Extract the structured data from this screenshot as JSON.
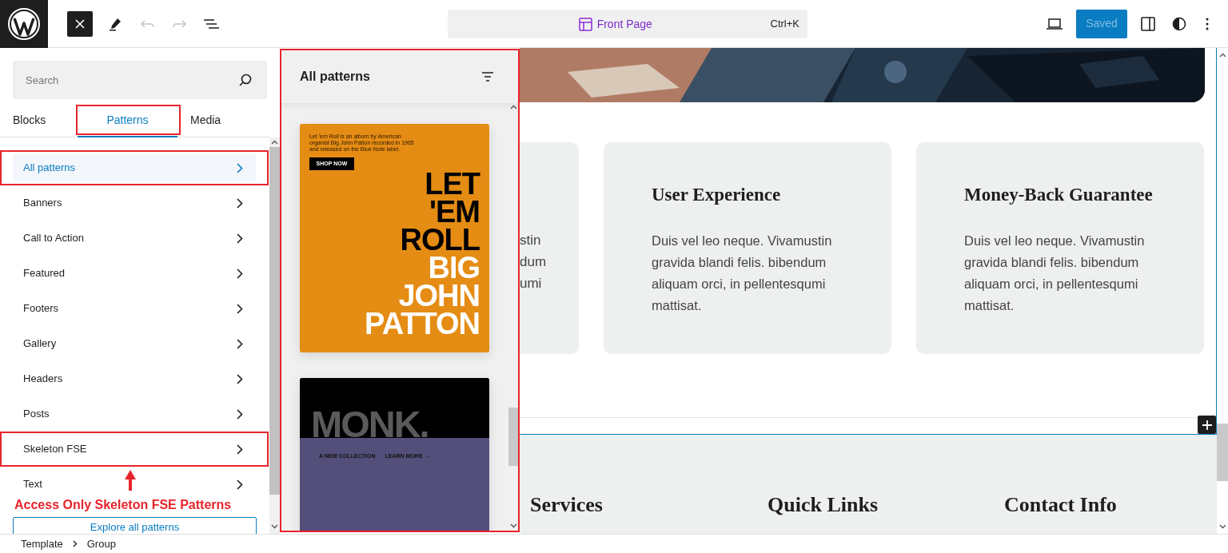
{
  "toolbar": {
    "history": [
      {
        "kind": "undo",
        "disabled": true
      },
      {
        "kind": "redo",
        "disabled": true
      }
    ],
    "command_bar": {
      "title": "Front Page",
      "shortcut": "Ctrl+K"
    },
    "save_button": "Saved"
  },
  "inserter": {
    "search": {
      "placeholder": "Search"
    },
    "tabs": [
      {
        "label": "Blocks",
        "selected": false,
        "highlighted": false
      },
      {
        "label": "Patterns",
        "selected": true,
        "highlighted": true
      },
      {
        "label": "Media",
        "selected": false,
        "highlighted": false
      }
    ],
    "categories": [
      {
        "label": "All patterns",
        "selected": true,
        "highlighted": true
      },
      {
        "label": "Banners",
        "selected": false,
        "highlighted": false
      },
      {
        "label": "Call to Action",
        "selected": false,
        "highlighted": false
      },
      {
        "label": "Featured",
        "selected": false,
        "highlighted": false
      },
      {
        "label": "Footers",
        "selected": false,
        "highlighted": false
      },
      {
        "label": "Gallery",
        "selected": false,
        "highlighted": false
      },
      {
        "label": "Headers",
        "selected": false,
        "highlighted": false
      },
      {
        "label": "Posts",
        "selected": false,
        "highlighted": false
      },
      {
        "label": "Skeleton FSE",
        "selected": false,
        "highlighted": true
      },
      {
        "label": "Text",
        "selected": false,
        "highlighted": false
      }
    ],
    "annotation": "Access Only Skeleton FSE Patterns",
    "explore_button": "Explore all patterns"
  },
  "patterns_panel": {
    "title": "All patterns",
    "highlighted": true,
    "patterns": [
      {
        "kind": "album",
        "blurb": "Let 'em Roll is an album by American organist Big John Patton recorded in 1965 and released on the Blue Note label.",
        "button": "SHOP NOW",
        "dark_lines": [
          "LET",
          "'EM",
          "ROLL"
        ],
        "light_lines": [
          "BIG",
          "JOHN",
          "PATTON"
        ]
      },
      {
        "kind": "collection",
        "headline": "MONK.",
        "links": [
          "A NEW COLLECTION",
          "LEARN MORE →"
        ]
      }
    ]
  },
  "canvas": {
    "features": [
      {
        "kind": "partial",
        "lines": [
          "stin",
          "dum",
          "umi"
        ]
      },
      {
        "kind": "full",
        "title": "User Experience",
        "body": "Duis vel leo neque. Vivamustin gravida blandi felis. bibendum aliquam orci, in pellentesqumi mattisat."
      },
      {
        "kind": "full",
        "title": "Money-Back Guarantee",
        "body": "Duis vel leo neque. Vivamustin gravida blandi felis. bibendum aliquam orci, in pellentesqumi mattisat."
      }
    ],
    "footer_headings": [
      "Services",
      "Quick Links",
      "Contact Info"
    ]
  },
  "breadcrumb": [
    "Template",
    "Group"
  ]
}
